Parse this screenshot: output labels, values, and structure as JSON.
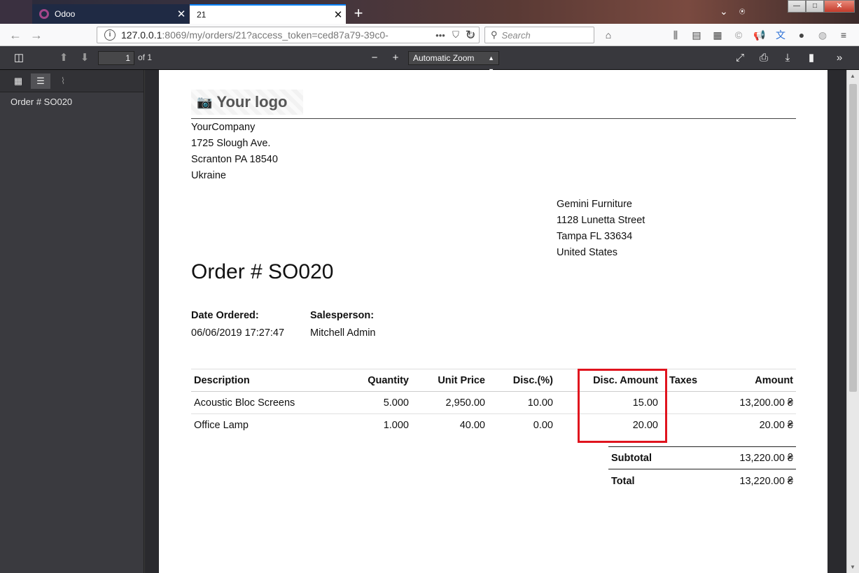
{
  "browser": {
    "tabs": [
      {
        "title": "Odoo"
      },
      {
        "title": "21"
      }
    ],
    "url_host": "127.0.0.1",
    "url_rest": ":8069/my/orders/21?access_token=ced87a79-39c0-",
    "search_placeholder": "Search"
  },
  "pdf_toolbar": {
    "page_number": "1",
    "page_of": "of 1",
    "zoom": "Automatic Zoom"
  },
  "sidebar": {
    "outline": [
      "Order # SO020"
    ]
  },
  "document": {
    "logo_text": "Your logo",
    "company": {
      "name": "YourCompany",
      "street": "1725 Slough Ave.",
      "city": "Scranton PA 18540",
      "country": "Ukraine"
    },
    "customer": {
      "name": "Gemini Furniture",
      "street": "1128 Lunetta Street",
      "city": "Tampa FL 33634",
      "country": "United States"
    },
    "title": "Order # SO020",
    "date_label": "Date Ordered:",
    "date_value": "06/06/2019 17:27:47",
    "salesperson_label": "Salesperson:",
    "salesperson_value": "Mitchell Admin",
    "columns": [
      "Description",
      "Quantity",
      "Unit Price",
      "Disc.(%)",
      "Disc. Amount",
      "Taxes",
      "Amount"
    ],
    "lines": [
      {
        "description": "Acoustic Bloc Screens",
        "quantity": "5.000",
        "unit_price": "2,950.00",
        "disc_pct": "10.00",
        "disc_amount": "15.00",
        "taxes": "",
        "amount": "13,200.00 ₴"
      },
      {
        "description": "Office Lamp",
        "quantity": "1.000",
        "unit_price": "40.00",
        "disc_pct": "0.00",
        "disc_amount": "20.00",
        "taxes": "",
        "amount": "20.00 ₴"
      }
    ],
    "subtotal_label": "Subtotal",
    "subtotal_value": "13,220.00 ₴",
    "total_label": "Total",
    "total_value": "13,220.00 ₴"
  },
  "colors": {
    "highlight": "#e0141e",
    "odoo_purple": "#a24689"
  }
}
